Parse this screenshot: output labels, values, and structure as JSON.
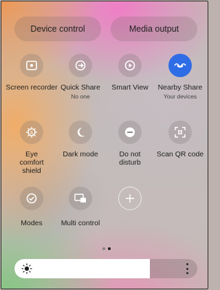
{
  "top": {
    "device_control": "Device control",
    "media_output": "Media output"
  },
  "tiles": [
    {
      "label": "Screen recorder",
      "sub": "",
      "icon": "screen-recorder-icon",
      "active": false
    },
    {
      "label": "Quick Share",
      "sub": "No one",
      "icon": "quick-share-icon",
      "active": false
    },
    {
      "label": "Smart View",
      "sub": "",
      "icon": "smart-view-icon",
      "active": false
    },
    {
      "label": "Nearby Share",
      "sub": "Your devices",
      "icon": "nearby-share-icon",
      "active": true
    },
    {
      "label": "Eye comfort shield",
      "sub": "",
      "icon": "eye-comfort-icon",
      "active": false
    },
    {
      "label": "Dark mode",
      "sub": "",
      "icon": "moon-icon",
      "active": false
    },
    {
      "label": "Do not disturb",
      "sub": "",
      "icon": "minus-circle-icon",
      "active": false
    },
    {
      "label": "Scan QR code",
      "sub": "",
      "icon": "qr-code-icon",
      "active": false
    },
    {
      "label": "Modes",
      "sub": "",
      "icon": "modes-check-icon",
      "active": false
    },
    {
      "label": "Multi control",
      "sub": "",
      "icon": "multi-control-icon",
      "active": false
    },
    {
      "label": "",
      "sub": "",
      "icon": "plus-icon",
      "active": false
    }
  ],
  "page_indicator": {
    "pages": 2,
    "current": 2
  },
  "brightness": {
    "level": 0.74,
    "icon": "sun-icon",
    "menu_icon": "more-vertical-icon"
  },
  "colors": {
    "active": "#2f6de6"
  }
}
